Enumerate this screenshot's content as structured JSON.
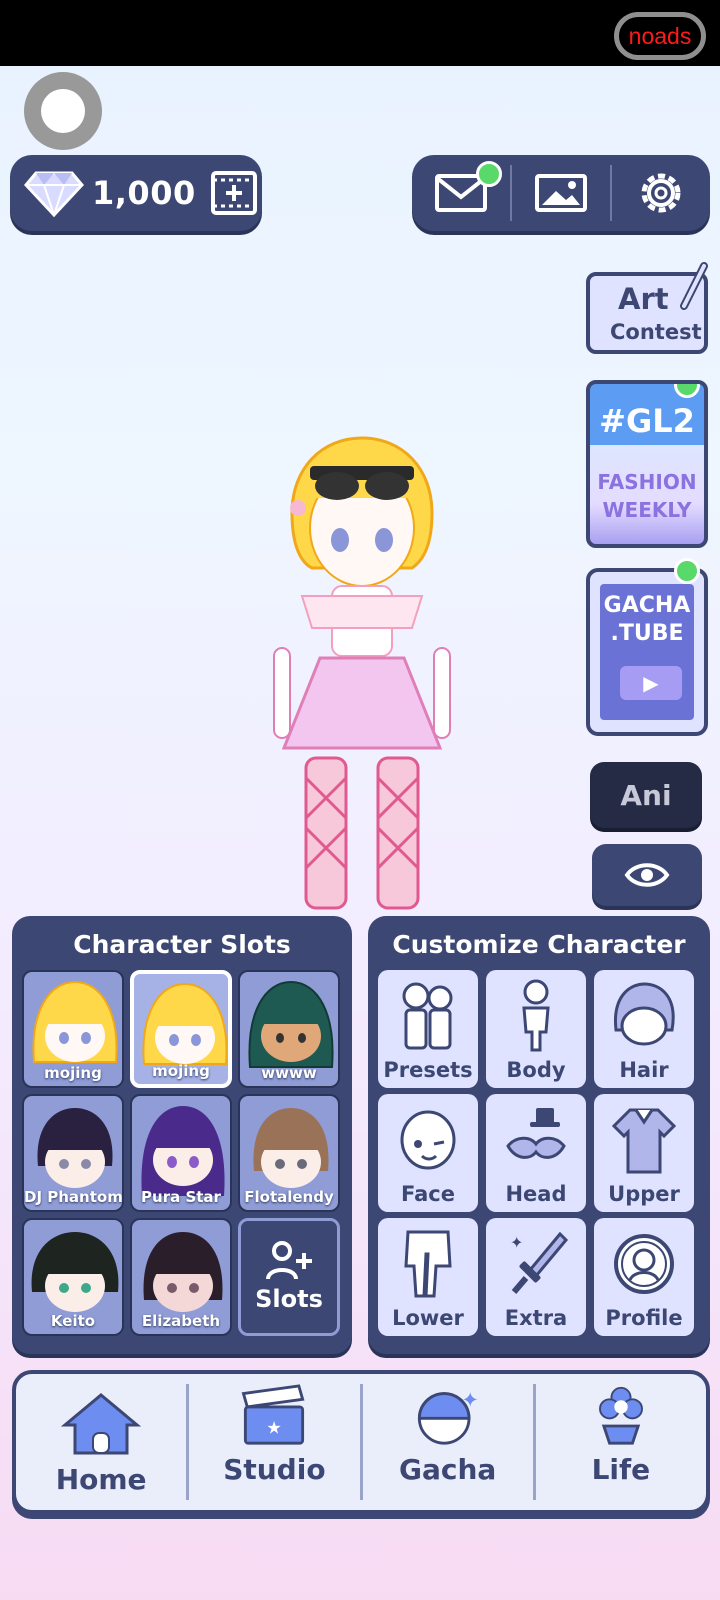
{
  "status_bar": {
    "noads_label": "noads"
  },
  "currency": {
    "gems": "1,000"
  },
  "top_actions": [
    {
      "name": "mail",
      "badge": true
    },
    {
      "name": "gallery",
      "badge": false
    },
    {
      "name": "settings",
      "badge": false
    }
  ],
  "side_cards": {
    "art_contest": {
      "line1": "Art",
      "line2": "Contest"
    },
    "gl2": {
      "line1": "#GL2",
      "line2": "FASHION",
      "line3": "WEEKLY"
    },
    "gacha_tube": {
      "line1": "GACHA",
      "line2": ".TUBE"
    },
    "ani_label": "Ani"
  },
  "character_slots": {
    "title": "Character Slots",
    "slots": [
      {
        "name": "mojing",
        "selected": false
      },
      {
        "name": "mojing",
        "selected": true
      },
      {
        "name": "wwww",
        "selected": false
      },
      {
        "name": "DJ Phantom",
        "selected": false
      },
      {
        "name": "Pura Star",
        "selected": false
      },
      {
        "name": "Flotalendy",
        "selected": false
      },
      {
        "name": "Keito",
        "selected": false
      },
      {
        "name": "Elizabeth",
        "selected": false
      }
    ],
    "add_label": "Slots"
  },
  "customize": {
    "title": "Customize Character",
    "buttons": [
      "Presets",
      "Body",
      "Hair",
      "Face",
      "Head",
      "Upper",
      "Lower",
      "Extra",
      "Profile"
    ]
  },
  "bottom_nav": [
    "Home",
    "Studio",
    "Gacha",
    "Life"
  ],
  "colors": {
    "panel": "#3c4774",
    "accent_green": "#58d96a",
    "tile": "#dfe3ff"
  }
}
